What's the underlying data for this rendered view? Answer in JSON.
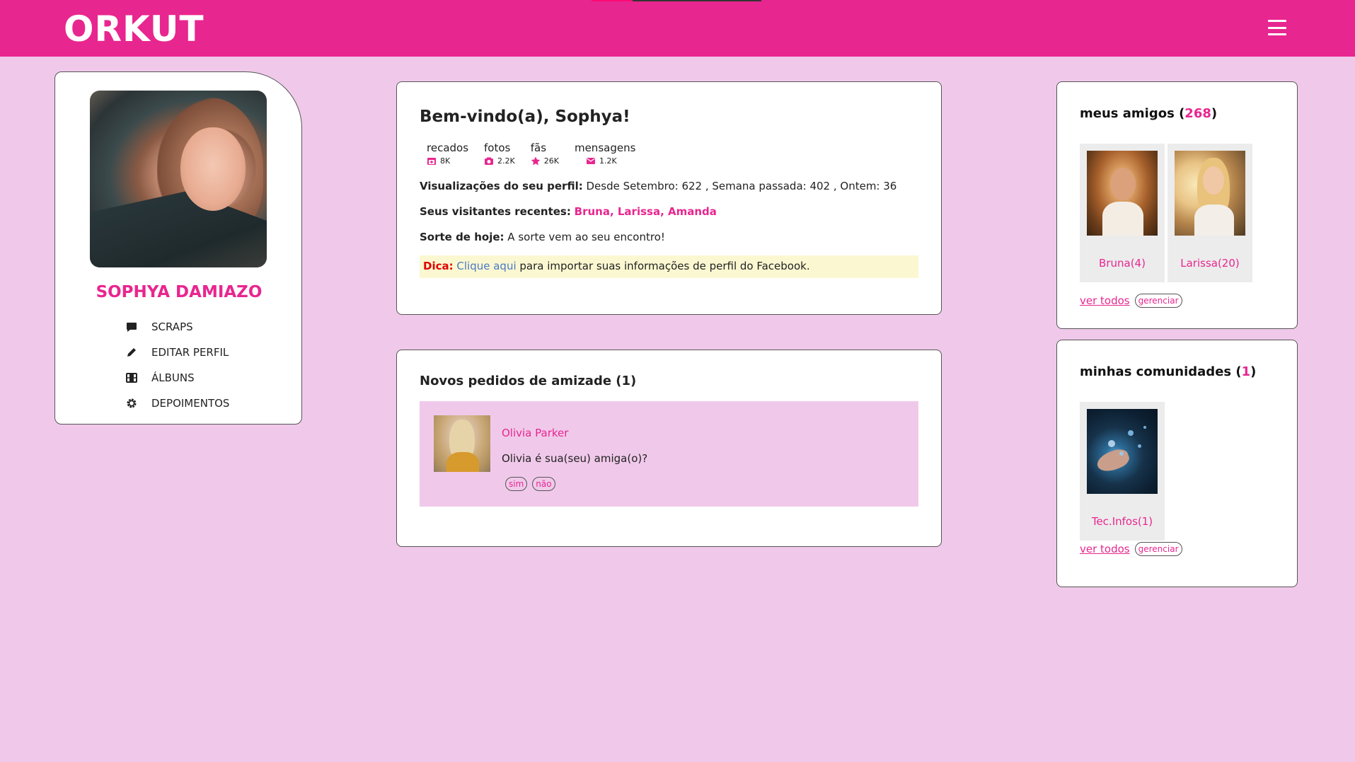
{
  "header": {
    "logo": "ORKUT",
    "menu_icon": "hamburger-menu-icon",
    "brand_color": "#e8268f",
    "background_color": "#f0c9ea",
    "loading_progress": 0.24
  },
  "profile": {
    "name": "SOPHYA DAMIAZO",
    "menu": [
      {
        "label": "SCRAPS",
        "icon": "comment-icon"
      },
      {
        "label": "EDITAR PERFIL",
        "icon": "pencil-icon"
      },
      {
        "label": "ÁLBUNS",
        "icon": "film-icon"
      },
      {
        "label": "DEPOIMENTOS",
        "icon": "gear-icon"
      }
    ]
  },
  "welcome": {
    "title": "Bem-vindo(a), Sophya!",
    "stats": [
      {
        "label": "recados",
        "value": "8K",
        "icon": "calendar-plus-icon"
      },
      {
        "label": "fotos",
        "value": "2.2K",
        "icon": "camera-icon"
      },
      {
        "label": "fãs",
        "value": "26K",
        "icon": "star-icon"
      },
      {
        "label": "mensagens",
        "value": "1.2K",
        "icon": "envelope-icon"
      }
    ],
    "views_label": "Visualizações do seu perfil:",
    "views_text": "Desde Setembro: 622 , Semana passada: 402 , Ontem: 36",
    "visitors_label": "Seus visitantes recentes:",
    "visitors": [
      "Bruna",
      "Larissa",
      "Amanda"
    ],
    "visitors_sep": ", ",
    "luck_label": "Sorte de hoje:",
    "luck_text": "A sorte vem ao seu encontro!",
    "tip_label": "Dica:",
    "tip_link": "Clique aqui",
    "tip_text": "para importar suas informações de perfil do Facebook."
  },
  "requests": {
    "title": "Novos pedidos de amizade (1)",
    "items": [
      {
        "name": "Olivia Parker",
        "question": "Olivia é sua(seu) amiga(o)?",
        "yes": "sim",
        "no": "não"
      }
    ]
  },
  "friends": {
    "title": "meus amigos",
    "count": "268",
    "items": [
      {
        "caption": "Bruna(4)"
      },
      {
        "caption": "Larissa(20)"
      }
    ],
    "see_all": "ver todos",
    "manage": "gerenciar"
  },
  "communities": {
    "title": "minhas comunidades",
    "count": "1",
    "items": [
      {
        "caption": "Tec.Infos(1)"
      }
    ],
    "see_all": "ver todos",
    "manage": "gerenciar"
  }
}
